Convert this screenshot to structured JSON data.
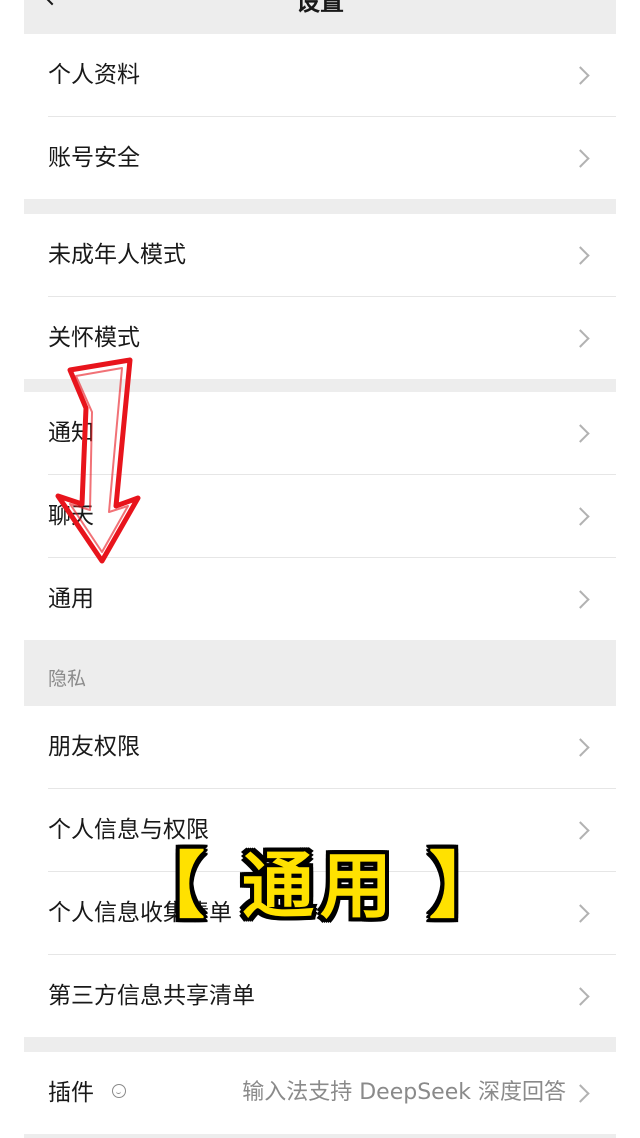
{
  "header": {
    "title": "设置",
    "back_icon": "chevron-left-icon"
  },
  "groups": {
    "account": [
      "个人资料",
      "账号安全"
    ],
    "modes": [
      "未成年人模式",
      "关怀模式"
    ],
    "general": [
      "通知",
      "聊天",
      "通用"
    ],
    "privacy": [
      "朋友权限",
      "个人信息与权限",
      "个人信息收集清单",
      "第三方信息共享清单"
    ]
  },
  "privacy_section_title": "隐私",
  "plugins": {
    "label": "插件",
    "badge_icon": "plugin-badge-icon",
    "value": "输入法支持 DeepSeek 深度回答"
  },
  "overlay": {
    "caption": "【 通用 】",
    "arrow_color": "#e8141c",
    "caption_color": "#ffe100"
  },
  "colors": {
    "page_bg": "#ededed",
    "cell_bg": "#ffffff",
    "secondary_text": "#8a8a8a"
  }
}
